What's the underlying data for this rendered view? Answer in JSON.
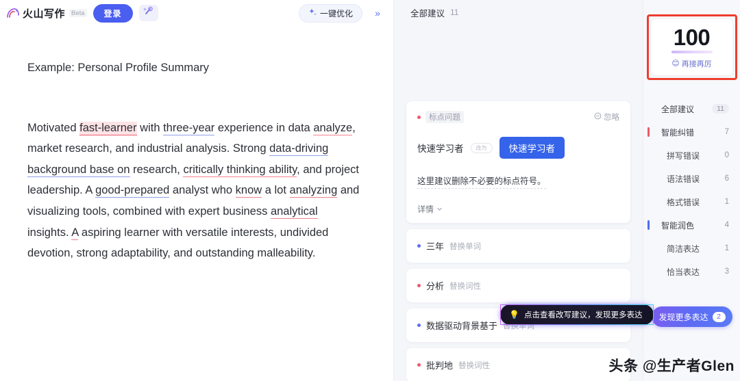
{
  "header": {
    "logo_text": "火山写作",
    "beta_tag": "Beta",
    "login_label": "登录",
    "magic_icon": "magic-wand-icon",
    "optimize_label": "一键优化",
    "optimize_icon": "sparkle-icon",
    "expand_icon": "double-chevron-right-icon",
    "expand_label": "»"
  },
  "document": {
    "title": "Example: Personal Profile Summary",
    "paragraph_runs": [
      {
        "text": "Motivated ",
        "style": "plain"
      },
      {
        "text": "fast-learner",
        "style": "error-highlight"
      },
      {
        "text": " with ",
        "style": "plain"
      },
      {
        "text": "three-year",
        "style": "polish"
      },
      {
        "text": " experience in data ",
        "style": "plain"
      },
      {
        "text": "analyze",
        "style": "error"
      },
      {
        "text": ", market research, and industrial analysis. Strong ",
        "style": "plain"
      },
      {
        "text": "data-driving background base on",
        "style": "polish"
      },
      {
        "text": " research, ",
        "style": "plain"
      },
      {
        "text": "critically thinking ability",
        "style": "error"
      },
      {
        "text": ", and project leadership. A ",
        "style": "plain"
      },
      {
        "text": "good-prepared",
        "style": "polish"
      },
      {
        "text": " analyst who ",
        "style": "plain"
      },
      {
        "text": "know",
        "style": "error"
      },
      {
        "text": " a lot ",
        "style": "plain"
      },
      {
        "text": "analyzing",
        "style": "error"
      },
      {
        "text": " and visualizing tools, combined with expert business ",
        "style": "plain"
      },
      {
        "text": "analytical",
        "style": "error"
      },
      {
        "text": " insights. ",
        "style": "plain"
      },
      {
        "text": "A",
        "style": "error"
      },
      {
        "text": " aspiring learner with versatile interests, undivided devotion, strong adaptability, and outstanding malleability.",
        "style": "plain"
      }
    ]
  },
  "suggestions": {
    "header_label": "全部建议",
    "header_count": "11",
    "card": {
      "tag": "标点问题",
      "ignore_label": "忽略",
      "ignore_icon": "minus-circle-icon",
      "original": "快速学习者",
      "arrow_label": "改为",
      "replacement": "快速学习者",
      "description": "这里建议删除不必要的标点符号。",
      "detail_label": "详情",
      "detail_icon": "chevron-down-icon"
    },
    "items": [
      {
        "text": "三年",
        "action": "替换单词",
        "color": "#5b6ef5"
      },
      {
        "text": "分析",
        "action": "替换词性",
        "color": "#f0566b"
      },
      {
        "text": "数据驱动背景基于",
        "action": "替换单词",
        "color": "#5b6ef5"
      },
      {
        "text": "批判地",
        "action": "替换词性",
        "color": "#f0566b"
      }
    ],
    "tooltip": {
      "icon": "lightbulb-icon",
      "text": "点击查看改写建议，发现更多表达"
    }
  },
  "sidebar": {
    "score": "100",
    "score_caption": "再接再厉",
    "score_emoji": "😊",
    "nav": [
      {
        "name": "全部建议",
        "value": "11",
        "style": "pill",
        "bar": ""
      },
      {
        "name": "智能纠错",
        "value": "7",
        "style": "group",
        "bar": "#f0566b"
      },
      {
        "name": "拼写错误",
        "value": "0",
        "style": "sub",
        "bar": ""
      },
      {
        "name": "语法错误",
        "value": "6",
        "style": "sub",
        "bar": ""
      },
      {
        "name": "格式错误",
        "value": "1",
        "style": "sub",
        "bar": ""
      },
      {
        "name": "智能润色",
        "value": "4",
        "style": "group",
        "bar": "#4a6ef0"
      },
      {
        "name": "简洁表达",
        "value": "1",
        "style": "sub",
        "bar": ""
      },
      {
        "name": "恰当表达",
        "value": "3",
        "style": "sub",
        "bar": ""
      }
    ],
    "discover_label": "发现更多表达",
    "discover_badge": "2"
  },
  "watermark": "头条 @生产者Glen",
  "colors": {
    "accent_blue": "#4a5ef0",
    "error_red": "#f0566b",
    "polish_blue": "#8f9fe6",
    "annotation_red": "#ef3d2e",
    "suggestion_blue": "#3563e9"
  }
}
